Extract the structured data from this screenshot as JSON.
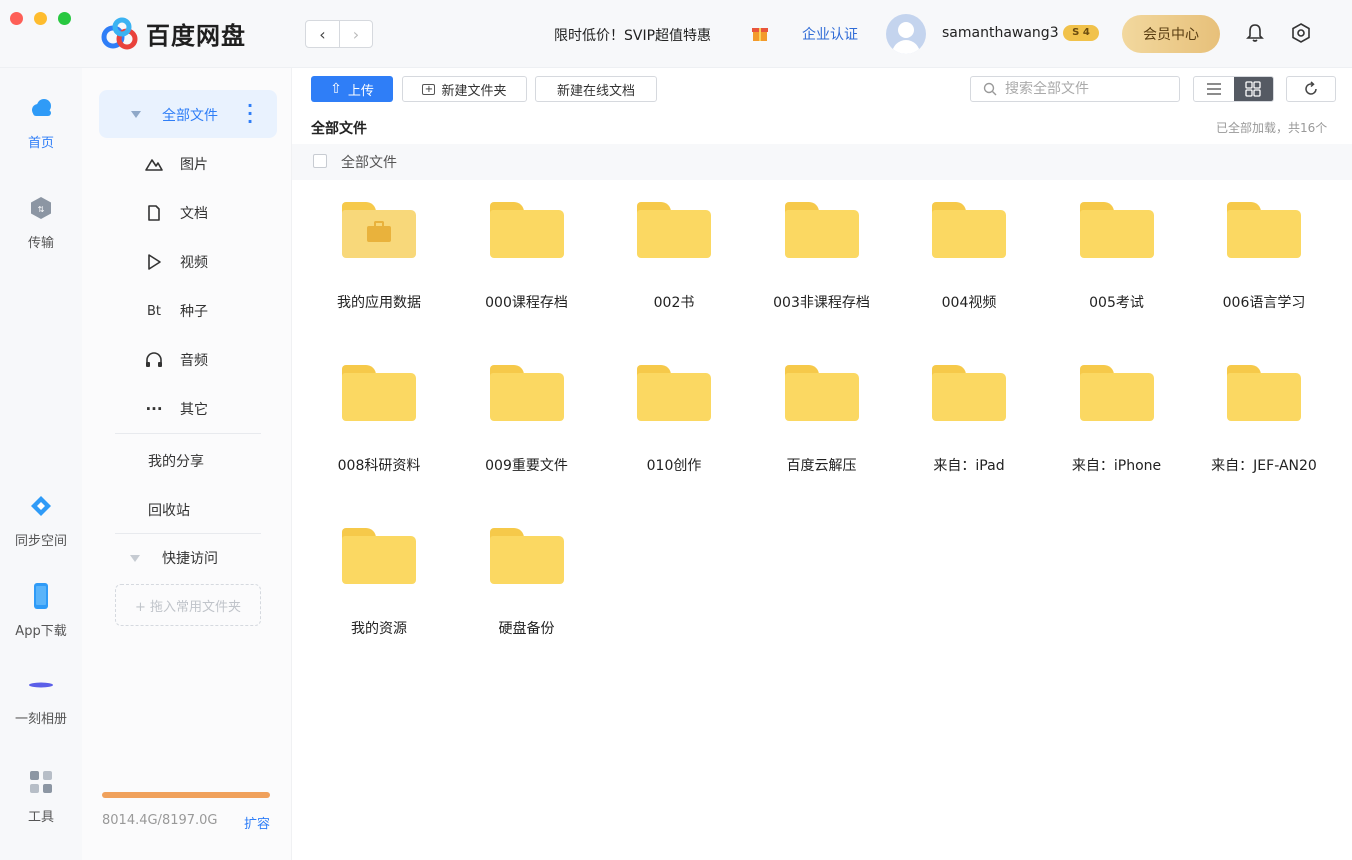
{
  "app": {
    "title": "百度网盘"
  },
  "topbar": {
    "promo": "限时低价！SVIP超值特惠",
    "enterprise": "企业认证",
    "username": "samanthawang3",
    "vip_badge": "S 4",
    "vip_center": "会员中心"
  },
  "rail": [
    {
      "label": "首页",
      "icon": "cloud-icon"
    },
    {
      "label": "传输",
      "icon": "transfer-icon"
    },
    {
      "label": "同步空间",
      "icon": "sync-icon"
    },
    {
      "label": "App下载",
      "icon": "phone-icon"
    },
    {
      "label": "一刻相册",
      "icon": "album-icon"
    },
    {
      "label": "工具",
      "icon": "tools-icon"
    }
  ],
  "sidebar": {
    "all_files": "全部文件",
    "items": [
      {
        "label": "图片",
        "icon": "image-icon"
      },
      {
        "label": "文档",
        "icon": "document-icon"
      },
      {
        "label": "视频",
        "icon": "video-icon"
      },
      {
        "label": "种子",
        "icon": "torrent-icon",
        "glyph": "Bt"
      },
      {
        "label": "音频",
        "icon": "headphones-icon"
      },
      {
        "label": "其它",
        "icon": "more-icon",
        "glyph": "···"
      }
    ],
    "my_share": "我的分享",
    "recycle": "回收站",
    "quick_access": "快捷访问",
    "drop_hint": "+ 拖入常用文件夹",
    "storage": {
      "used_text": "8014.4G/8197.0G",
      "used_fraction": 0.978,
      "expand": "扩容"
    }
  },
  "toolbar": {
    "upload": "上传",
    "new_folder": "新建文件夹",
    "new_doc": "新建在线文档",
    "search_placeholder": "搜索全部文件"
  },
  "main": {
    "breadcrumb": "全部文件",
    "loaded_status": "已全部加载，共16个",
    "header_label": "全部文件",
    "files": [
      {
        "name": "我的应用数据",
        "special": true
      },
      {
        "name": "000课程存档"
      },
      {
        "name": "002书"
      },
      {
        "name": "003非课程存档"
      },
      {
        "name": "004视频"
      },
      {
        "name": "005考试"
      },
      {
        "name": "006语言学习"
      },
      {
        "name": "008科研资料"
      },
      {
        "name": "009重要文件"
      },
      {
        "name": "010创作"
      },
      {
        "name": "百度云解压"
      },
      {
        "name": "来自：iPad"
      },
      {
        "name": "来自：iPhone"
      },
      {
        "name": "来自：JEF-AN20"
      },
      {
        "name": "我的资源"
      },
      {
        "name": "硬盘备份"
      }
    ]
  },
  "colors": {
    "accent": "#2f7ef7",
    "folder": "#fbd862",
    "storage": "#f0a15c"
  }
}
